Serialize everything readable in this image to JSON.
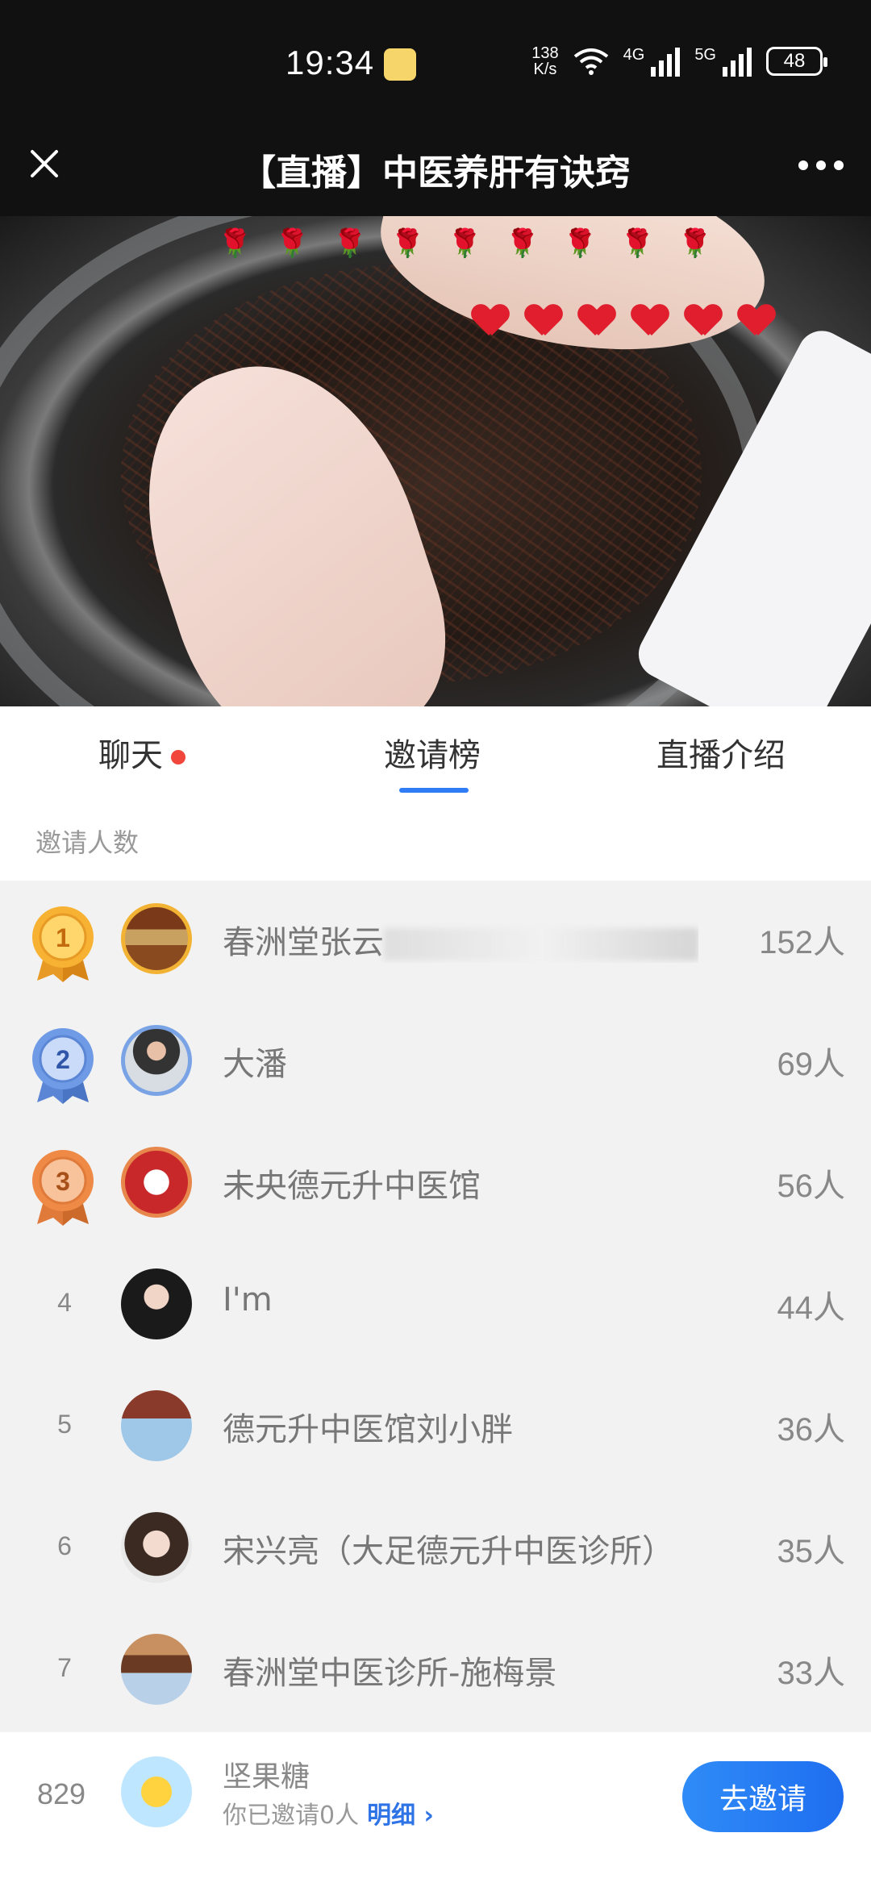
{
  "status_bar": {
    "time": "19:34",
    "net_speed_top": "138",
    "net_speed_bottom": "K/s",
    "net1": "4G",
    "net2": "5G",
    "battery": "48"
  },
  "header": {
    "title": "【直播】中医养肝有诀窍"
  },
  "tabs": [
    {
      "label": "聊天",
      "has_dot": true
    },
    {
      "label": "邀请榜",
      "active": true
    },
    {
      "label": "直播介绍"
    }
  ],
  "subhead": "邀请人数",
  "ranking": [
    {
      "rank": "1",
      "name": "春洲堂张云",
      "count": "152人",
      "medal": "gold"
    },
    {
      "rank": "2",
      "name": "大潘",
      "count": "69人",
      "medal": "silver"
    },
    {
      "rank": "3",
      "name": "未央德元升中医馆",
      "count": "56人",
      "medal": "bronze"
    },
    {
      "rank": "4",
      "name": "I'm",
      "count": "44人"
    },
    {
      "rank": "5",
      "name": "德元升中医馆刘小胖",
      "count": "36人"
    },
    {
      "rank": "6",
      "name": "宋兴亮（大足德元升中医诊所）",
      "count": "35人"
    },
    {
      "rank": "7",
      "name": "春洲堂中医诊所-施梅景",
      "count": "33人"
    }
  ],
  "me": {
    "rank": "829",
    "name": "坚果糖",
    "invited_text": "你已邀请0人",
    "detail_label": "明细 ›",
    "invite_button": "去邀请"
  },
  "colors": {
    "accent": "#2f7cf6",
    "dot": "#f0463c"
  }
}
